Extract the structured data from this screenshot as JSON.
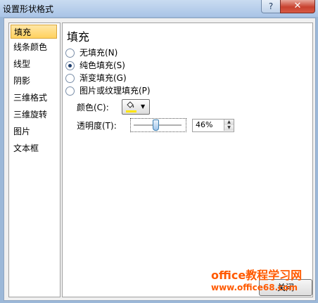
{
  "window": {
    "title": "设置形状格式",
    "help_glyph": "?",
    "close_glyph": "✕"
  },
  "nav": {
    "items": [
      {
        "label": "填充",
        "selected": true
      },
      {
        "label": "线条颜色"
      },
      {
        "label": "线型"
      },
      {
        "label": "阴影"
      },
      {
        "label": "三维格式"
      },
      {
        "label": "三维旋转"
      },
      {
        "label": "图片"
      },
      {
        "label": "文本框"
      }
    ]
  },
  "fill": {
    "heading": "填充",
    "options": [
      {
        "label": "无填充(N)",
        "checked": false
      },
      {
        "label": "纯色填充(S)",
        "checked": true
      },
      {
        "label": "渐变填充(G)",
        "checked": false
      },
      {
        "label": "图片或纹理填充(P)",
        "checked": false
      }
    ],
    "color_label": "颜色(C):",
    "color_value": "#ffe500",
    "transparency_label": "透明度(T):",
    "transparency_value": "46%",
    "transparency_fraction": 0.46
  },
  "footer": {
    "close_label": "关闭"
  },
  "watermark": {
    "line1": "office教程学习网",
    "line2": "www.office68.com"
  }
}
